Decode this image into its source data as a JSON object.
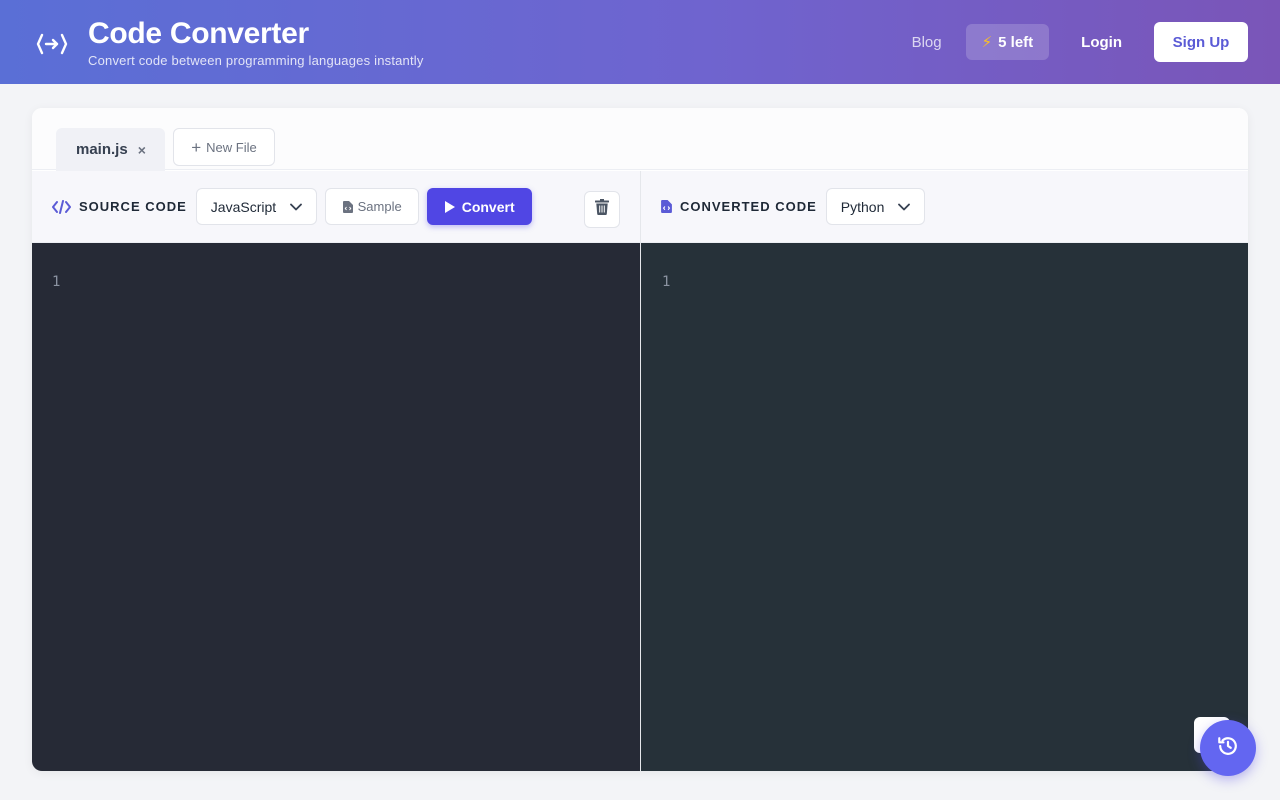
{
  "header": {
    "logo_icon": "code-brackets-arrow-icon",
    "title": "Code Converter",
    "subtitle": "Convert code between programming languages instantly",
    "nav": {
      "blog": "Blog",
      "credits_icon": "⚡",
      "credits": "5 left",
      "login": "Login",
      "signup": "Sign Up"
    }
  },
  "tabs": {
    "files": [
      {
        "label": "main.js",
        "close": "×"
      }
    ],
    "new_file_icon": "+",
    "new_file": "New File"
  },
  "source": {
    "title": "SOURCE CODE",
    "language": "JavaScript",
    "sample": "Sample",
    "convert": "Convert",
    "line_numbers": [
      "1"
    ]
  },
  "target": {
    "title": "CONVERTED CODE",
    "language": "Python",
    "line_numbers": [
      "1"
    ]
  },
  "colors": {
    "accent": "#5046e4",
    "header_gradient_start": "#5a6fd6",
    "header_gradient_end": "#7a55b8",
    "source_editor_bg": "#262a36",
    "target_editor_bg": "#263139"
  }
}
